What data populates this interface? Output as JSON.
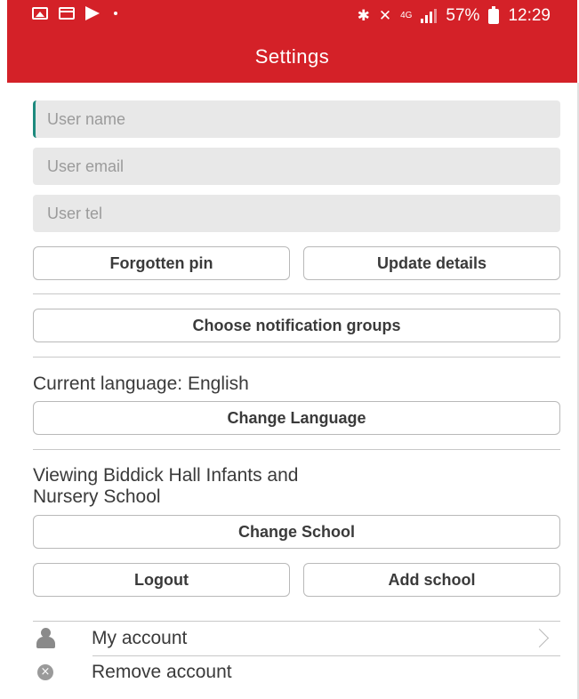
{
  "status_bar": {
    "battery": "57%",
    "time": "12:29",
    "network": "4G"
  },
  "header": {
    "title": "Settings"
  },
  "form": {
    "user_name_placeholder": "User name",
    "user_email_placeholder": "User email",
    "user_tel_placeholder": "User tel"
  },
  "buttons": {
    "forgotten_pin": "Forgotten pin",
    "update_details": "Update details",
    "choose_notification_groups": "Choose notification groups",
    "change_language": "Change Language",
    "change_school": "Change School",
    "logout": "Logout",
    "add_school": "Add school"
  },
  "language": {
    "current_label": "Current language: English"
  },
  "school": {
    "viewing_line1": "Viewing Biddick Hall Infants and",
    "viewing_line2": "Nursery School"
  },
  "account_list": {
    "items": [
      {
        "label": "My account",
        "icon": "person-icon"
      },
      {
        "label": "Remove account",
        "icon": "remove-circle-icon"
      }
    ]
  },
  "colors": {
    "header_bg": "#d42128",
    "field_bg": "#e8e8e8",
    "cursor": "#1e8a7e"
  }
}
